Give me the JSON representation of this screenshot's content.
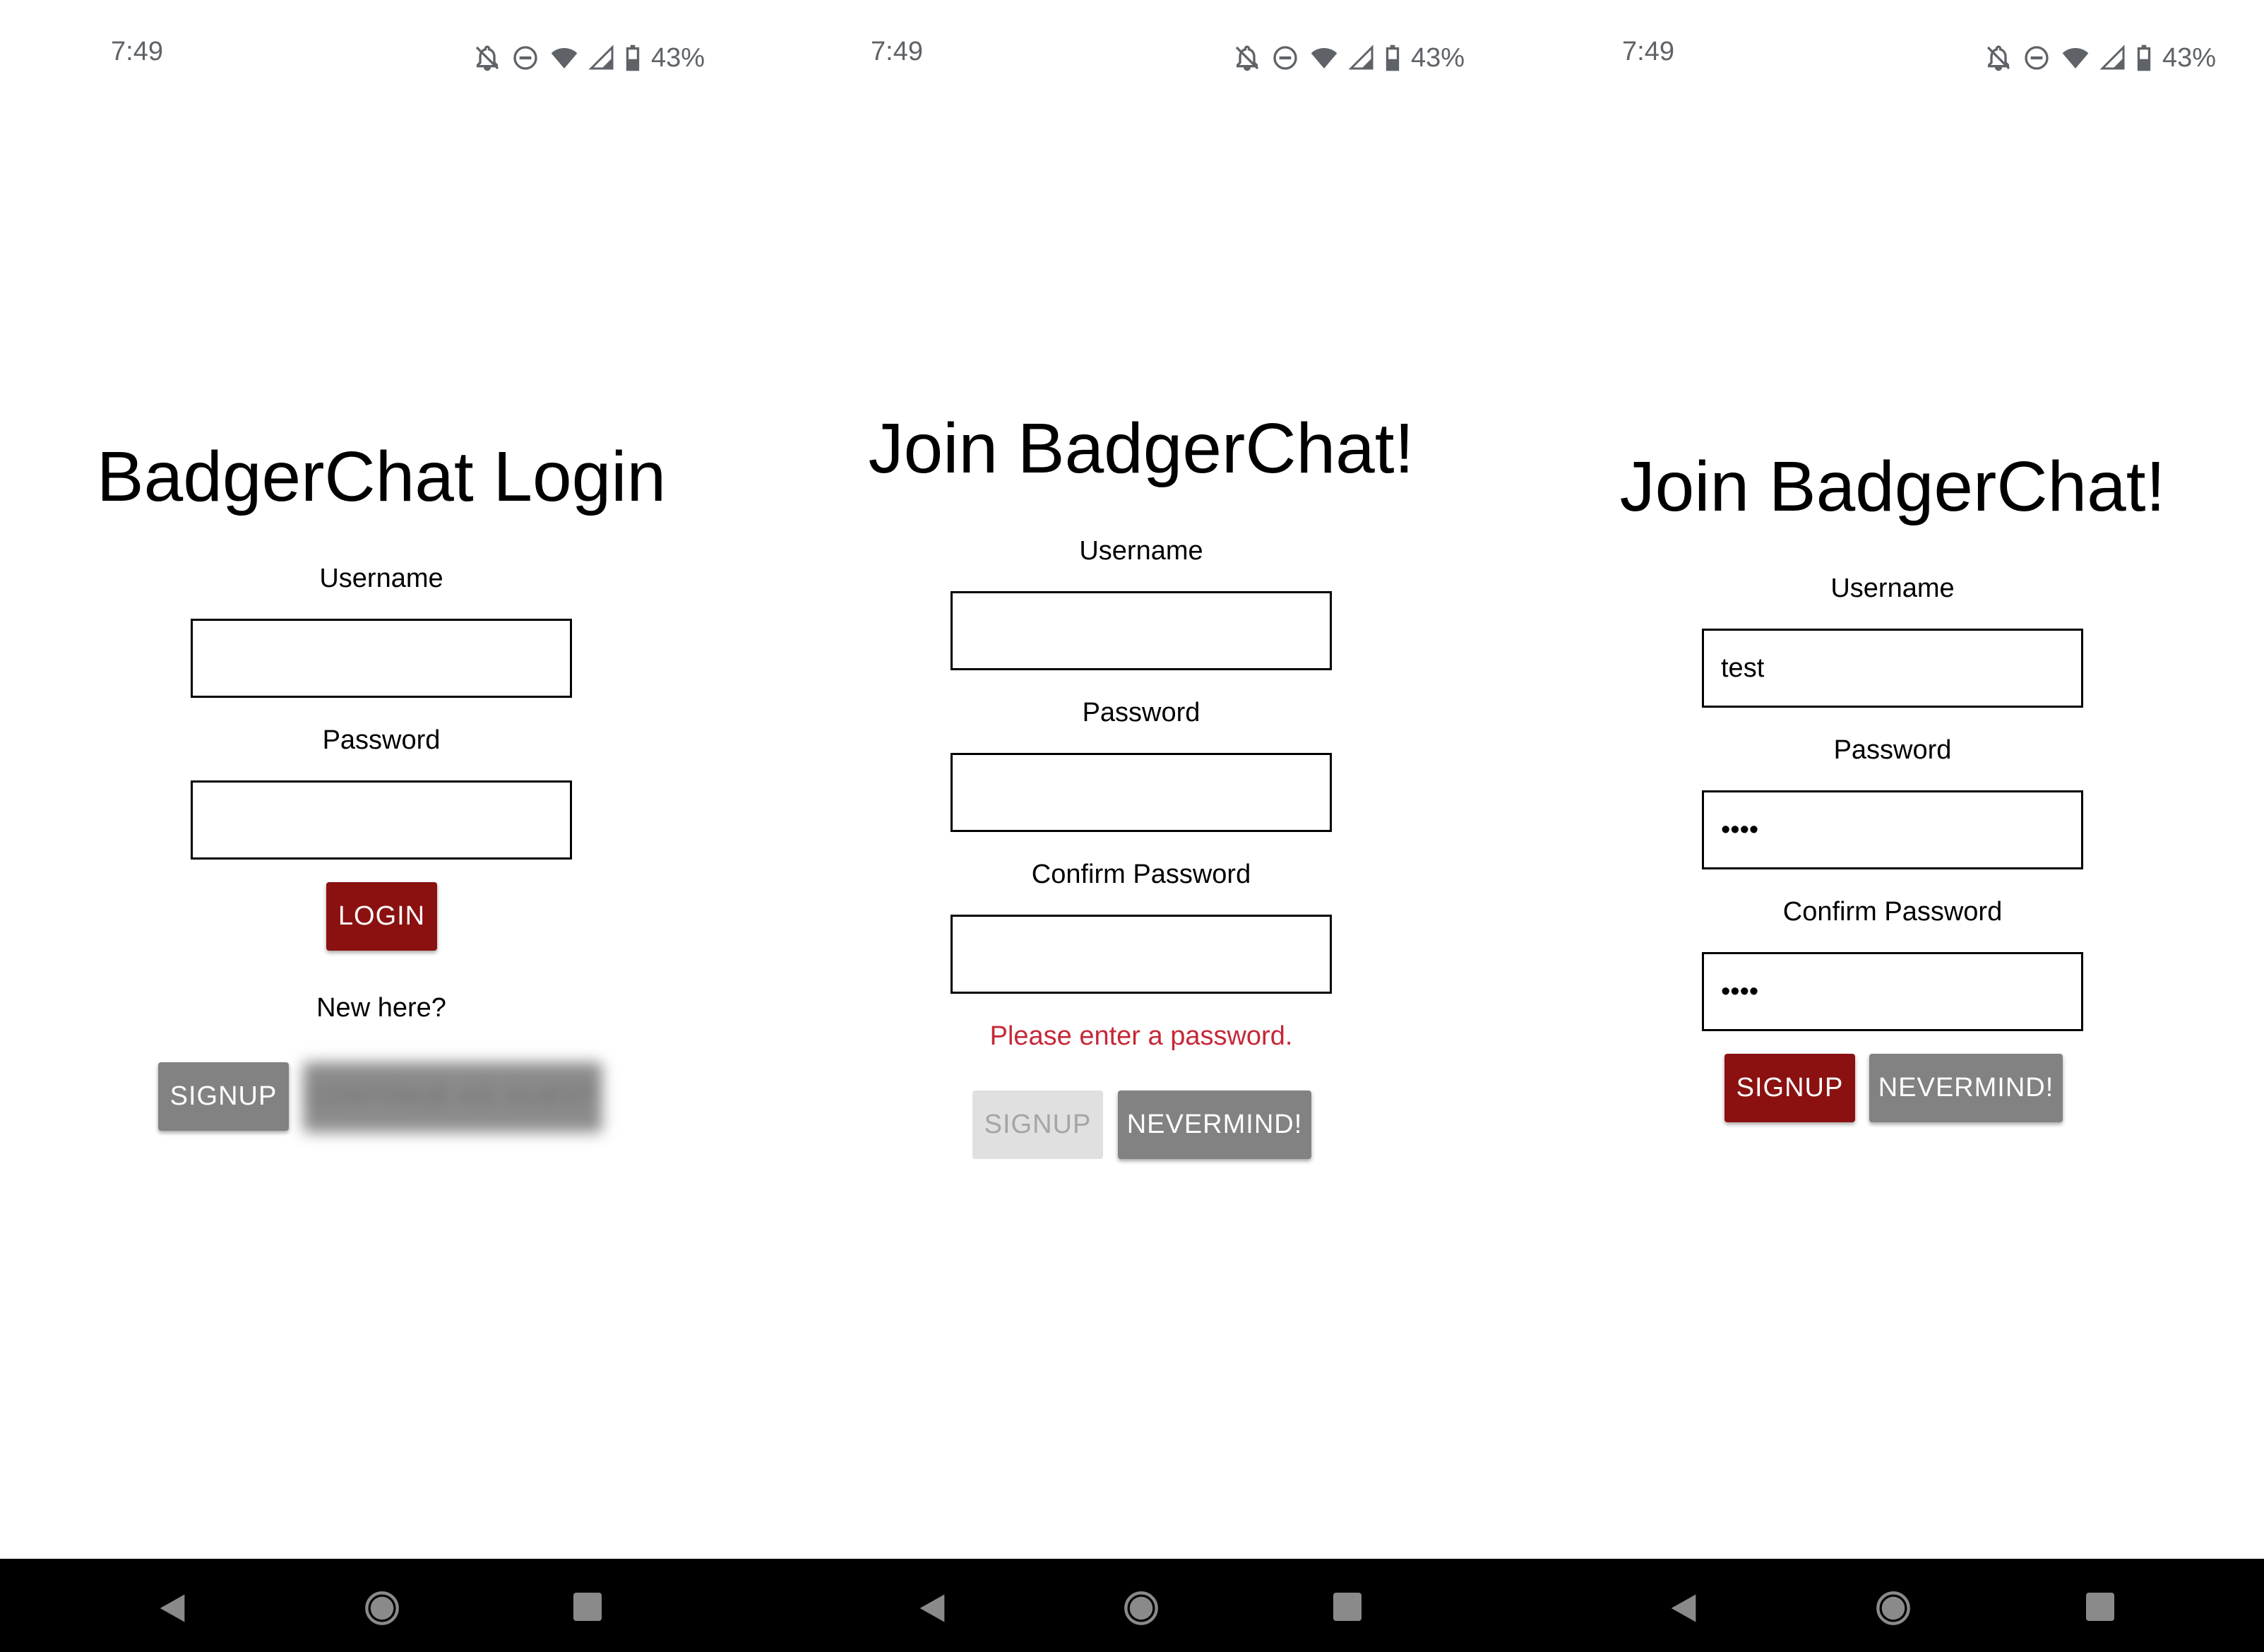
{
  "status_bar": {
    "time": "7:49",
    "battery": "43%"
  },
  "screens": [
    {
      "title": "BadgerChat Login",
      "username_label": "Username",
      "username_value": "",
      "password_label": "Password",
      "password_value": "",
      "login_button": "LOGIN",
      "new_here": "New here?",
      "signup_button": "SIGNUP",
      "guest_button": "CONTINUE AS GUEST"
    },
    {
      "title": "Join BadgerChat!",
      "username_label": "Username",
      "username_value": "",
      "password_label": "Password",
      "password_value": "",
      "confirm_label": "Confirm Password",
      "confirm_value": "",
      "error": "Please enter a password.",
      "signup_button": "SIGNUP",
      "nevermind_button": "NEVERMIND!"
    },
    {
      "title": "Join BadgerChat!",
      "username_label": "Username",
      "username_value": "test",
      "password_label": "Password",
      "password_value": "••••",
      "confirm_label": "Confirm Password",
      "confirm_value": "••••",
      "signup_button": "SIGNUP",
      "nevermind_button": "NEVERMIND!"
    }
  ],
  "colors": {
    "primary": "#8b1111",
    "secondary": "#828282",
    "error": "#c62838",
    "disabled": "#e0e0e0"
  },
  "icons": [
    "bell-off-icon",
    "do-not-disturb-icon",
    "wifi-icon",
    "cell-signal-icon",
    "battery-icon",
    "back-icon",
    "home-icon",
    "recents-icon"
  ]
}
